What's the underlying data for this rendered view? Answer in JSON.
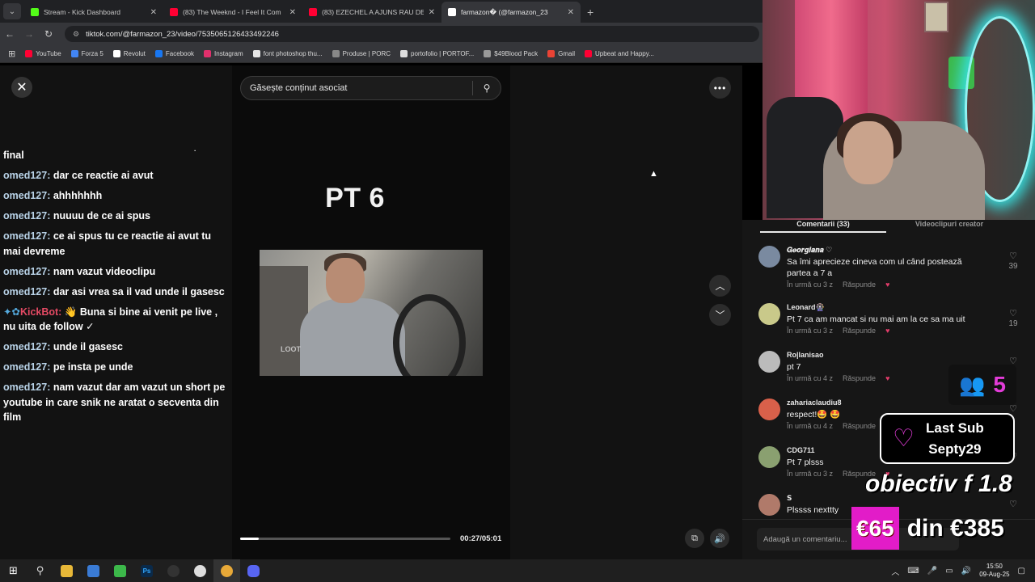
{
  "browser": {
    "tabs": [
      {
        "title": "Stream - Kick Dashboard",
        "color": "#53fc18",
        "active": false
      },
      {
        "title": "(83) The Weeknd - I Feel It Com",
        "color": "#ff0033",
        "active": false
      },
      {
        "title": "(83) EZECHEL A AJUNS RAU DE",
        "color": "#ff0033",
        "active": false
      },
      {
        "title": "farmazon� (@farmazon_23",
        "color": "#ffffff",
        "active": true
      }
    ],
    "url": "tiktok.com/@farmazon_23/video/7535065126433492246",
    "bookmarks": [
      {
        "label": "YouTube",
        "color": "#ff0033"
      },
      {
        "label": "Forza 5",
        "color": "#4285f4"
      },
      {
        "label": "Revolut",
        "color": "#ffffff"
      },
      {
        "label": "Facebook",
        "color": "#1877f2"
      },
      {
        "label": "Instagram",
        "color": "#e1306c"
      },
      {
        "label": "font photoshop thu...",
        "color": "#e6e6e6"
      },
      {
        "label": "Produse | PORC",
        "color": "#888888"
      },
      {
        "label": "portofolio | PORTOF...",
        "color": "#dddddd"
      },
      {
        "label": "$49Blood Pack",
        "color": "#999999"
      },
      {
        "label": "Gmail",
        "color": "#ea4335"
      },
      {
        "label": "Upbeat and Happy...",
        "color": "#ff0033"
      }
    ]
  },
  "viewer": {
    "search_placeholder": "Găsește conținut asociat",
    "video_title": "PT 6",
    "watermark": "LOOT",
    "timecode": "00:27/05:01",
    "progress": 0.09
  },
  "chat": {
    "first_line": "final",
    "messages": [
      {
        "user": "omed127:",
        "text": "dar ce reactie ai avut"
      },
      {
        "user": "omed127:",
        "text": "ahhhhhhh"
      },
      {
        "user": "omed127:",
        "text": "nuuuu de ce ai spus"
      },
      {
        "user": "omed127:",
        "text": "ce ai spus tu ce reactie ai avut tu mai devreme"
      },
      {
        "user": "omed127:",
        "text": "nam vazut videoclipu"
      },
      {
        "user": "omed127:",
        "text": "dar asi vrea sa il vad unde il gasesc"
      },
      {
        "user": "KickBot:",
        "text": "👋 Buna si bine ai venit pe live , nu uita de follow ✓",
        "bot": true
      },
      {
        "user": "omed127:",
        "text": "unde il gasesc"
      },
      {
        "user": "omed127:",
        "text": "pe insta pe unde"
      },
      {
        "user": "omed127:",
        "text": "nam vazut dar am vazut un short pe youtube in care snik ne aratat o secventa din film"
      }
    ]
  },
  "comments": {
    "tabs": [
      "Comentarii (33)",
      "Videoclipuri creator"
    ],
    "reply_label": "Răspunde",
    "items": [
      {
        "name": "𝑮𝒆𝒐𝒓𝒈𝒊𝒂𝒏𝒂 ♡",
        "text": "Sa îmi aprecieze cineva com ul când postează partea a 7 a",
        "time": "În urmă cu 3 z",
        "likes": "39",
        "avatar": "#7a8aa0"
      },
      {
        "name": "Leonard🎡",
        "text": "Pt 7 ca am mancat si nu mai am la ce sa ma uit",
        "time": "În urmă cu 3 z",
        "likes": "19",
        "avatar": "#c9c98a"
      },
      {
        "name": "Ro|lanisao",
        "text": "pt 7",
        "time": "În urmă cu 4 z",
        "likes": "",
        "avatar": "#bbbbbb"
      },
      {
        "name": "zahariaclaudiu8",
        "text": "respect!🤩 🤩",
        "time": "În urmă cu 4 z",
        "likes": "",
        "avatar": "#d9604a"
      },
      {
        "name": "CDG711",
        "text": "Pt 7 plsss",
        "time": "În urmă cu 3 z",
        "likes": "",
        "avatar": "#8aa070"
      },
      {
        "name": "𝗦",
        "text": "Plssss nexttty",
        "time": "",
        "likes": "",
        "avatar": "#b07a6a"
      }
    ],
    "add_placeholder": "Adaugă un comentariu..."
  },
  "overlay": {
    "viewers": "5",
    "last_sub_label": "Last Sub",
    "last_sub_name": "Septy29",
    "objective": "obiectiv f 1.8",
    "goal_current": "€65",
    "goal_rest": "din €385"
  },
  "taskbar": {
    "time": "15:50",
    "date": "09-Aug-25"
  }
}
